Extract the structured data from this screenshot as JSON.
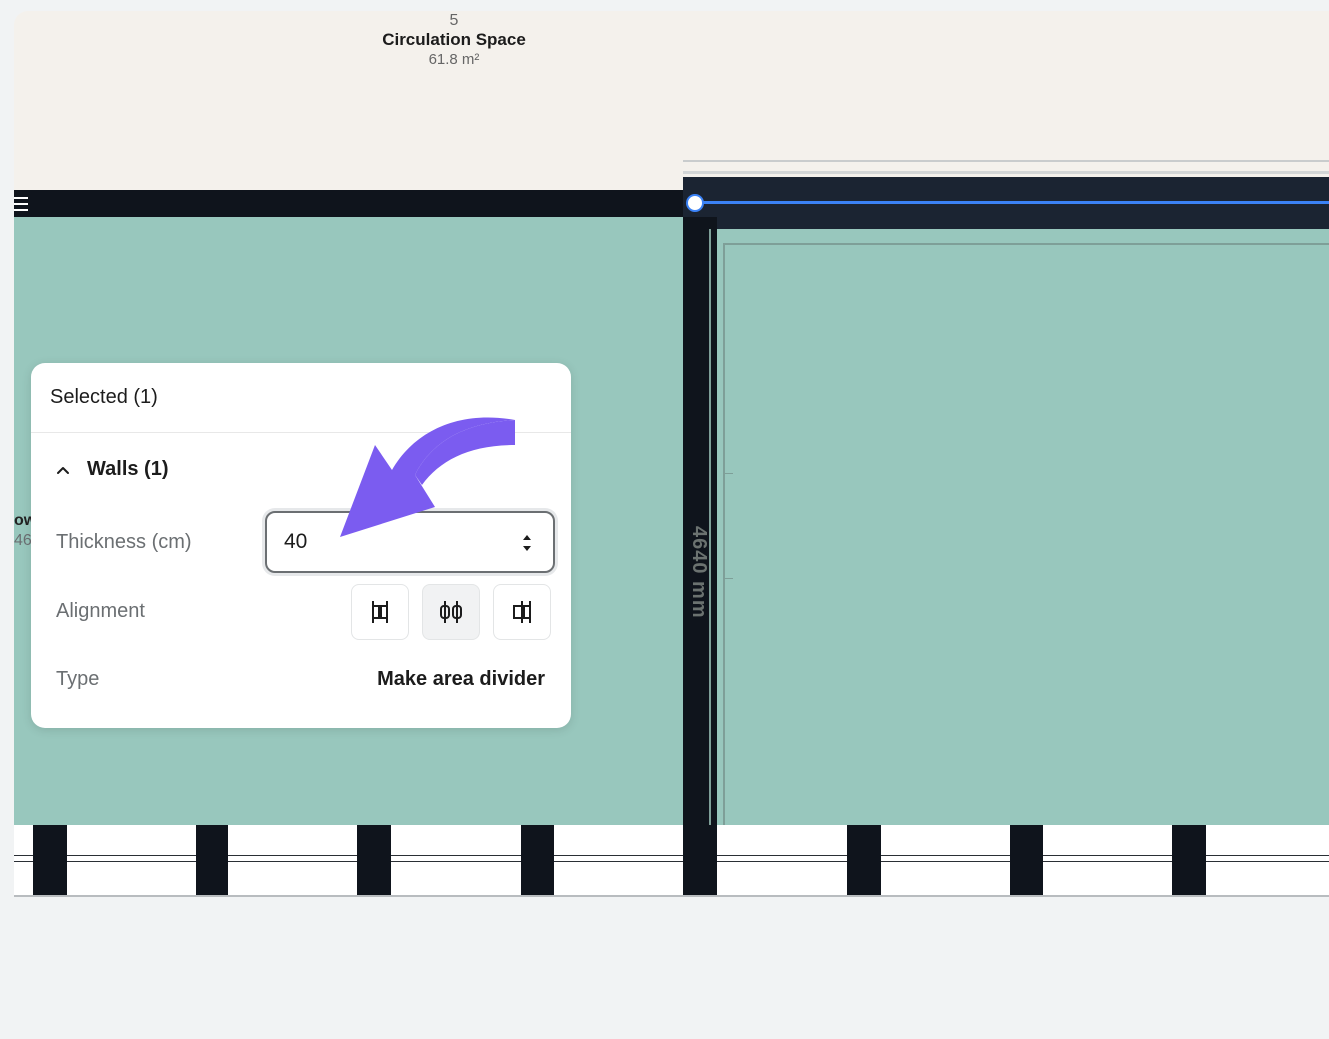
{
  "floorplan": {
    "room": {
      "number": "5",
      "name": "Circulation Space",
      "area": "61.8 m²"
    },
    "dimension_label": "4640 mm",
    "edge_text_top": "ow",
    "edge_text_bottom": "46",
    "colors": {
      "wall": "#0f141c",
      "room_fill": "#98c7bd",
      "corridor_fill": "#f4f1ec",
      "selection_line": "#3b82f6",
      "annotation_arrow": "#7b5cf0"
    }
  },
  "panel": {
    "title": "Selected (1)",
    "section_title": "Walls (1)",
    "section_icon": "chevron-up-icon",
    "thickness": {
      "label": "Thickness (cm)",
      "value": "40"
    },
    "alignment": {
      "label": "Alignment",
      "options": [
        "align-left-icon",
        "align-center-icon",
        "align-right-icon"
      ],
      "selected": "align-center-icon"
    },
    "type": {
      "label": "Type",
      "value": "Make area divider"
    }
  }
}
